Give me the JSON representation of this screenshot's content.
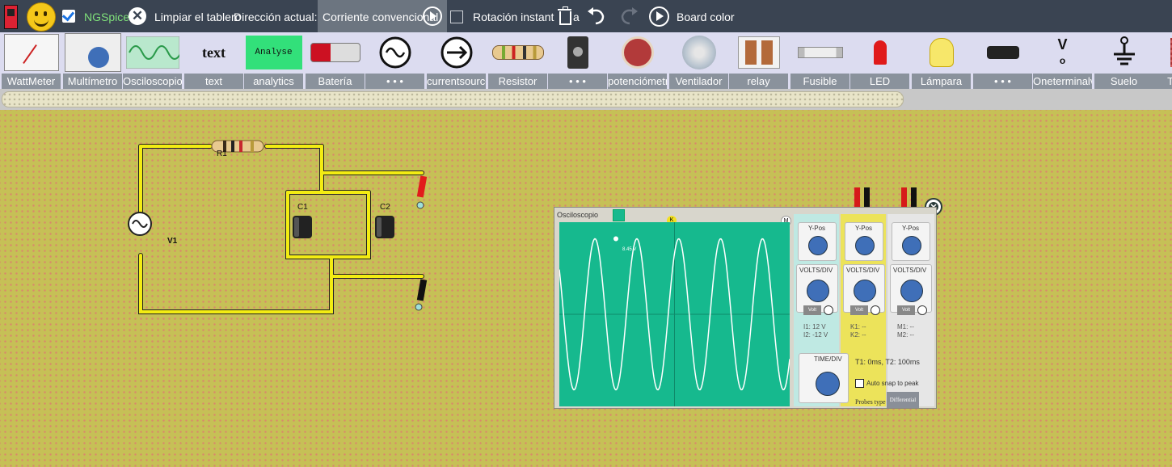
{
  "toolbar": {
    "ngspice_label": "NGSpice",
    "clear_label": "Limpiar el tablero",
    "direction_label": "Dirección actual:",
    "direction_value": "Corriente convencional",
    "rotation_label": "Rotación instant",
    "delete_suffix": "a",
    "board_color_label": "Board color"
  },
  "components": [
    {
      "label": "WattMeter",
      "icon": "wattmeter-icon"
    },
    {
      "label": "Multímetro",
      "icon": "multimeter-icon"
    },
    {
      "label": "Osciloscopio",
      "icon": "oscilloscope-icon"
    },
    {
      "label": "text",
      "icon": "text-icon",
      "preview": "text"
    },
    {
      "label": "analytics",
      "icon": "analytics-icon",
      "preview": "Analyse"
    },
    {
      "label": "Batería",
      "icon": "battery-icon"
    },
    {
      "label": "• • •",
      "icon": "ac-source-icon"
    },
    {
      "label": "currentsource",
      "icon": "current-source-icon"
    },
    {
      "label": "Resistor",
      "icon": "resistor-icon"
    },
    {
      "label": "• • •",
      "icon": "switch-icon"
    },
    {
      "label": "potenciómetro",
      "icon": "potentiometer-icon"
    },
    {
      "label": "Ventilador",
      "icon": "fan-icon"
    },
    {
      "label": "relay",
      "icon": "relay-icon"
    },
    {
      "label": "Fusible",
      "icon": "fuse-icon"
    },
    {
      "label": "LED",
      "icon": "led-icon"
    },
    {
      "label": "Lámpara",
      "icon": "lamp-icon"
    },
    {
      "label": "• • •",
      "icon": "capacitor-icon"
    },
    {
      "label": "Oneterminalvolt",
      "icon": "one-terminal-icon",
      "preview": "V"
    },
    {
      "label": "Suelo",
      "icon": "ground-icon"
    },
    {
      "label": "Trans",
      "icon": "transformer-icon"
    }
  ],
  "circuit": {
    "resistor_label": "R1",
    "source_label": "V1",
    "cap1_label": "C1",
    "cap2_label": "C2"
  },
  "oscilloscope": {
    "title": "Osciloscopio",
    "marker_k": "K",
    "marker_m": "M",
    "marker_i": "I",
    "peak_label": "8.45 V",
    "channels": [
      {
        "ypos": "Y-Pos",
        "volts": "VOLTS/DIV",
        "btn": "Volt",
        "line1": "I1: 12 V",
        "line2": "I2: -12 V",
        "color": "#bfe9e3"
      },
      {
        "ypos": "Y-Pos",
        "volts": "VOLTS/DIV",
        "btn": "Volt",
        "line1": "K1: --",
        "line2": "K2: --",
        "color": "#ece35a"
      },
      {
        "ypos": "Y-Pos",
        "volts": "VOLTS/DIV",
        "btn": "Volt",
        "line1": "M1: --",
        "line2": "M2: --",
        "color": "#e6e6e6"
      }
    ],
    "time_div": "TIME/DIV",
    "t_readout": "T1: 0ms, T2: 100ms",
    "auto_snap": "Auto snap to peak",
    "probes_type": "Probes type",
    "probes_value": "Differential",
    "wave": {
      "cycles": 5.5,
      "amplitude_fraction": 0.82
    }
  }
}
